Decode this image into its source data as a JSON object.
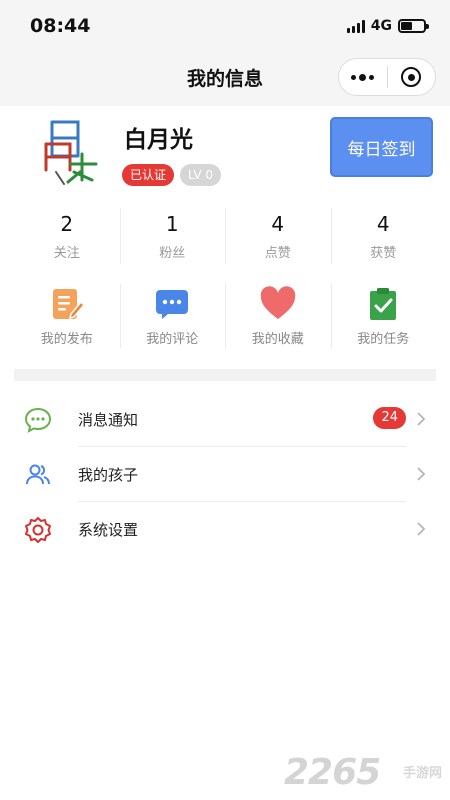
{
  "status_bar": {
    "time": "08:44",
    "network": "4G",
    "battery_level": 0.5
  },
  "nav": {
    "title": "我的信息"
  },
  "profile": {
    "name": "白月光",
    "verified_label": "已认证",
    "level_label": "LV 0",
    "signin_label": "每日签到"
  },
  "stats": [
    {
      "value": "2",
      "label": "关注"
    },
    {
      "value": "1",
      "label": "粉丝"
    },
    {
      "value": "4",
      "label": "点赞"
    },
    {
      "value": "4",
      "label": "获赞"
    }
  ],
  "actions": [
    {
      "label": "我的发布",
      "icon": "edit-document-icon",
      "color": "#f5a25d"
    },
    {
      "label": "我的评论",
      "icon": "comment-bubble-icon",
      "color": "#4a86e8"
    },
    {
      "label": "我的收藏",
      "icon": "heart-icon",
      "color": "#ef6b6b"
    },
    {
      "label": "我的任务",
      "icon": "clipboard-check-icon",
      "color": "#3aa34a"
    }
  ],
  "menu": [
    {
      "label": "消息通知",
      "icon": "message-bubble-icon",
      "badge": "24",
      "color": "#6ab04c"
    },
    {
      "label": "我的孩子",
      "icon": "users-icon",
      "color": "#4a86e8"
    },
    {
      "label": "系统设置",
      "icon": "gear-icon",
      "color": "#d63031"
    }
  ],
  "watermark": {
    "number": "2265",
    "text": "手游网"
  }
}
